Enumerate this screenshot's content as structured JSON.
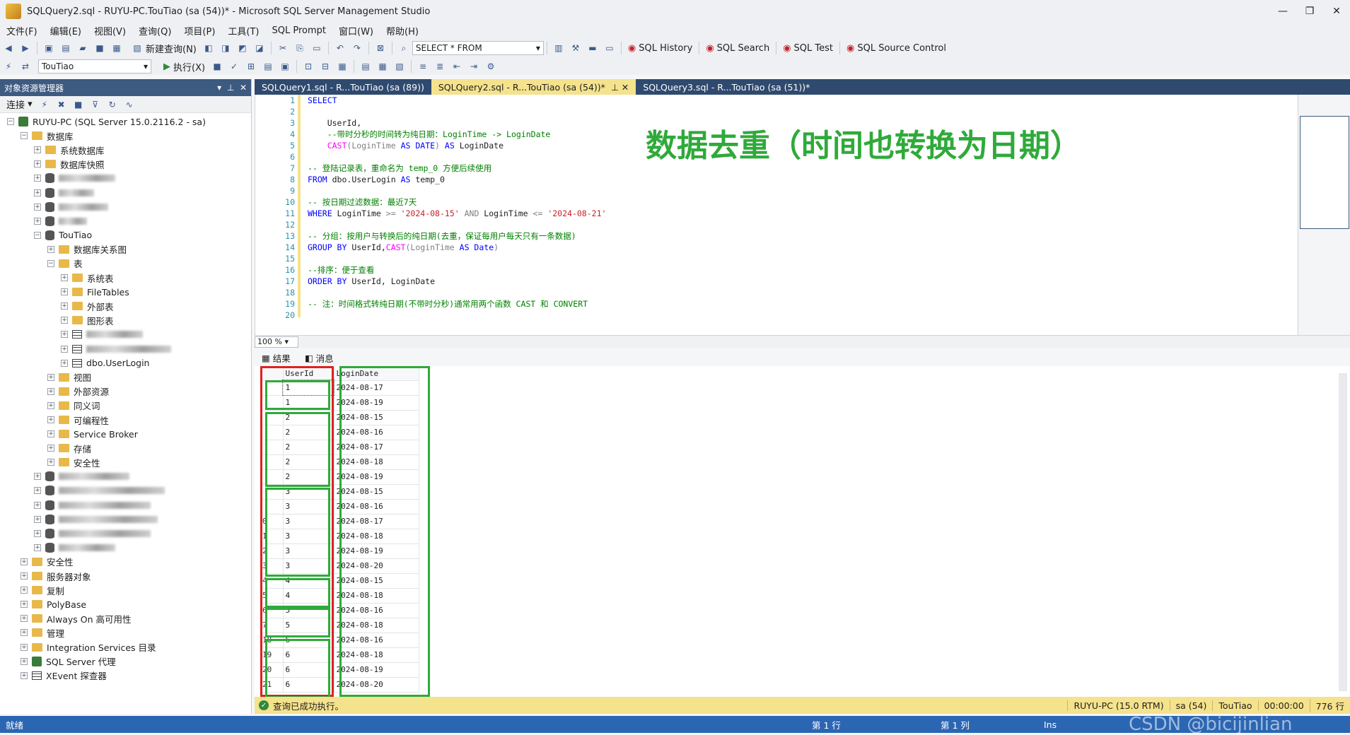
{
  "window": {
    "title": "SQLQuery2.sql - RUYU-PC.TouTiao (sa (54))* - Microsoft SQL Server Management Studio"
  },
  "menu": [
    "文件(F)",
    "编辑(E)",
    "视图(V)",
    "查询(Q)",
    "项目(P)",
    "工具(T)",
    "SQL Prompt",
    "窗口(W)",
    "帮助(H)"
  ],
  "toolbar": {
    "new_query": "新建查询(N)",
    "snippet_combo": "SELECT * FROM",
    "sql_history": "SQL History",
    "sql_search": "SQL Search",
    "sql_test": "SQL Test",
    "sql_source_control": "SQL Source Control",
    "database_combo": "TouTiao",
    "execute": "执行(X)"
  },
  "object_explorer": {
    "title": "对象资源管理器",
    "connect": "连接",
    "tree": [
      {
        "level": 0,
        "exp": "-",
        "icon": "server",
        "label": "RUYU-PC (SQL Server 15.0.2116.2 - sa)"
      },
      {
        "level": 1,
        "exp": "-",
        "icon": "folder",
        "label": "数据库"
      },
      {
        "level": 2,
        "exp": "+",
        "icon": "folder",
        "label": "系统数据库"
      },
      {
        "level": 2,
        "exp": "+",
        "icon": "folder",
        "label": "数据库快照"
      },
      {
        "level": 2,
        "exp": "+",
        "icon": "db",
        "label": "",
        "blur": 80
      },
      {
        "level": 2,
        "exp": "+",
        "icon": "db",
        "label": "",
        "blur": 50
      },
      {
        "level": 2,
        "exp": "+",
        "icon": "db",
        "label": "",
        "blur": 70
      },
      {
        "level": 2,
        "exp": "+",
        "icon": "db",
        "label": "",
        "blur": 40
      },
      {
        "level": 2,
        "exp": "-",
        "icon": "db",
        "label": "TouTiao"
      },
      {
        "level": 3,
        "exp": "+",
        "icon": "folder",
        "label": "数据库关系图"
      },
      {
        "level": 3,
        "exp": "-",
        "icon": "folder",
        "label": "表"
      },
      {
        "level": 4,
        "exp": "+",
        "icon": "folder",
        "label": "系统表"
      },
      {
        "level": 4,
        "exp": "+",
        "icon": "folder",
        "label": "FileTables"
      },
      {
        "level": 4,
        "exp": "+",
        "icon": "folder",
        "label": "外部表"
      },
      {
        "level": 4,
        "exp": "+",
        "icon": "folder",
        "label": "图形表"
      },
      {
        "level": 4,
        "exp": "+",
        "icon": "table",
        "label": "",
        "blur": 80
      },
      {
        "level": 4,
        "exp": "+",
        "icon": "table",
        "label": "",
        "blur": 120
      },
      {
        "level": 4,
        "exp": "+",
        "icon": "table",
        "label": "dbo.UserLogin"
      },
      {
        "level": 3,
        "exp": "+",
        "icon": "folder",
        "label": "视图"
      },
      {
        "level": 3,
        "exp": "+",
        "icon": "folder",
        "label": "外部资源"
      },
      {
        "level": 3,
        "exp": "+",
        "icon": "folder",
        "label": "同义词"
      },
      {
        "level": 3,
        "exp": "+",
        "icon": "folder",
        "label": "可编程性"
      },
      {
        "level": 3,
        "exp": "+",
        "icon": "folder",
        "label": "Service Broker"
      },
      {
        "level": 3,
        "exp": "+",
        "icon": "folder",
        "label": "存储"
      },
      {
        "level": 3,
        "exp": "+",
        "icon": "folder",
        "label": "安全性"
      },
      {
        "level": 2,
        "exp": "+",
        "icon": "db",
        "label": "",
        "blur": 100
      },
      {
        "level": 2,
        "exp": "+",
        "icon": "db",
        "label": "",
        "blur": 150
      },
      {
        "level": 2,
        "exp": "+",
        "icon": "db",
        "label": "",
        "blur": 130
      },
      {
        "level": 2,
        "exp": "+",
        "icon": "db",
        "label": "",
        "blur": 140
      },
      {
        "level": 2,
        "exp": "+",
        "icon": "db",
        "label": "",
        "blur": 130
      },
      {
        "level": 2,
        "exp": "+",
        "icon": "db",
        "label": "",
        "blur": 80
      },
      {
        "level": 1,
        "exp": "+",
        "icon": "folder",
        "label": "安全性"
      },
      {
        "level": 1,
        "exp": "+",
        "icon": "folder",
        "label": "服务器对象"
      },
      {
        "level": 1,
        "exp": "+",
        "icon": "folder",
        "label": "复制"
      },
      {
        "level": 1,
        "exp": "+",
        "icon": "folder",
        "label": "PolyBase"
      },
      {
        "level": 1,
        "exp": "+",
        "icon": "folder",
        "label": "Always On 高可用性"
      },
      {
        "level": 1,
        "exp": "+",
        "icon": "folder",
        "label": "管理"
      },
      {
        "level": 1,
        "exp": "+",
        "icon": "folder",
        "label": "Integration Services 目录"
      },
      {
        "level": 1,
        "exp": "+",
        "icon": "server",
        "label": "SQL Server 代理"
      },
      {
        "level": 1,
        "exp": "+",
        "icon": "xevent",
        "label": "XEvent 探查器"
      }
    ]
  },
  "doc_tabs": [
    {
      "label": "SQLQuery1.sql - R...TouTiao (sa (89))",
      "active": false
    },
    {
      "label": "SQLQuery2.sql - R...TouTiao (sa (54))*",
      "active": true
    },
    {
      "label": "SQLQuery3.sql - R...TouTiao (sa (51))*",
      "active": false
    }
  ],
  "editor": {
    "overlay_title": "数据去重（时间也转换为日期）",
    "lines": [
      [
        {
          "t": "SELECT",
          "c": "kw"
        }
      ],
      [],
      [
        {
          "t": "    UserId,",
          "c": ""
        }
      ],
      [
        {
          "t": "    --带时分秒的时间转为纯日期：LoginTime -> LoginDate",
          "c": "cm"
        }
      ],
      [
        {
          "t": "    ",
          "c": ""
        },
        {
          "t": "CAST",
          "c": "fn"
        },
        {
          "t": "(LoginTime ",
          "c": "gy"
        },
        {
          "t": "AS DATE",
          "c": "kw"
        },
        {
          "t": ") ",
          "c": "gy"
        },
        {
          "t": "AS",
          "c": "kw"
        },
        {
          "t": " LoginDate",
          "c": ""
        }
      ],
      [],
      [
        {
          "t": "-- 登陆记录表，重命名为 temp_0 方便后续使用",
          "c": "cm"
        }
      ],
      [
        {
          "t": "FROM",
          "c": "kw"
        },
        {
          "t": " dbo.UserLogin ",
          "c": ""
        },
        {
          "t": "AS",
          "c": "kw"
        },
        {
          "t": " temp_0",
          "c": ""
        }
      ],
      [],
      [
        {
          "t": "-- 按日期过滤数据：最近7天",
          "c": "cm"
        }
      ],
      [
        {
          "t": "WHERE",
          "c": "kw"
        },
        {
          "t": " LoginTime ",
          "c": ""
        },
        {
          "t": ">=",
          "c": "gy"
        },
        {
          "t": " '2024-08-15' ",
          "c": "str"
        },
        {
          "t": "AND",
          "c": "gy"
        },
        {
          "t": " LoginTime ",
          "c": ""
        },
        {
          "t": "<=",
          "c": "gy"
        },
        {
          "t": " '2024-08-21'",
          "c": "str"
        }
      ],
      [],
      [
        {
          "t": "-- 分组：按用户与转换后的纯日期(去重，保证每用户每天只有一条数据)",
          "c": "cm"
        }
      ],
      [
        {
          "t": "GROUP BY",
          "c": "kw"
        },
        {
          "t": " UserId,",
          "c": ""
        },
        {
          "t": "CAST",
          "c": "fn"
        },
        {
          "t": "(LoginTime ",
          "c": "gy"
        },
        {
          "t": "AS Date",
          "c": "kw"
        },
        {
          "t": ")",
          "c": "gy"
        }
      ],
      [],
      [
        {
          "t": "--排序：便于查看",
          "c": "cm"
        }
      ],
      [
        {
          "t": "ORDER BY",
          "c": "kw"
        },
        {
          "t": " UserId, LoginDate",
          "c": ""
        }
      ],
      [],
      [
        {
          "t": "-- 注：时间格式转纯日期(不带时分秒)通常用两个函数 CAST 和 CONVERT",
          "c": "cm"
        }
      ],
      []
    ]
  },
  "zoom": "100 %",
  "results": {
    "tab_results": "结果",
    "tab_messages": "消息",
    "columns": [
      "UserId",
      "LoginDate"
    ],
    "rows": [
      [
        "1",
        "2024-08-17"
      ],
      [
        "1",
        "2024-08-19"
      ],
      [
        "2",
        "2024-08-15"
      ],
      [
        "2",
        "2024-08-16"
      ],
      [
        "2",
        "2024-08-17"
      ],
      [
        "2",
        "2024-08-18"
      ],
      [
        "2",
        "2024-08-19"
      ],
      [
        "3",
        "2024-08-15"
      ],
      [
        "3",
        "2024-08-16"
      ],
      [
        "3",
        "2024-08-17"
      ],
      [
        "3",
        "2024-08-18"
      ],
      [
        "3",
        "2024-08-19"
      ],
      [
        "3",
        "2024-08-20"
      ],
      [
        "4",
        "2024-08-15"
      ],
      [
        "4",
        "2024-08-18"
      ],
      [
        "5",
        "2024-08-16"
      ],
      [
        "5",
        "2024-08-18"
      ],
      [
        "6",
        "2024-08-16"
      ],
      [
        "6",
        "2024-08-18"
      ],
      [
        "6",
        "2024-08-19"
      ],
      [
        "6",
        "2024-08-20"
      ]
    ],
    "row_numbers": [
      "",
      "",
      "",
      "",
      "",
      "",
      "",
      "",
      "",
      "0",
      "1",
      "2",
      "3",
      "4",
      "5",
      "6",
      "7",
      "18",
      "19",
      "20",
      "21"
    ]
  },
  "query_status": {
    "message": "查询已成功执行。",
    "server": "RUYU-PC (15.0 RTM)",
    "user": "sa (54)",
    "database": "TouTiao",
    "time": "00:00:00",
    "rows": "776 行"
  },
  "statusbar": {
    "ready": "就绪",
    "line": "第 1 行",
    "col": "第 1 列",
    "ins": "Ins",
    "watermark": "CSDN @bicijinlian"
  },
  "colors": {
    "accent": "#2b66b3",
    "tab_active": "#f5e28c",
    "box_green": "#2faa3a",
    "box_red": "#e02020"
  }
}
